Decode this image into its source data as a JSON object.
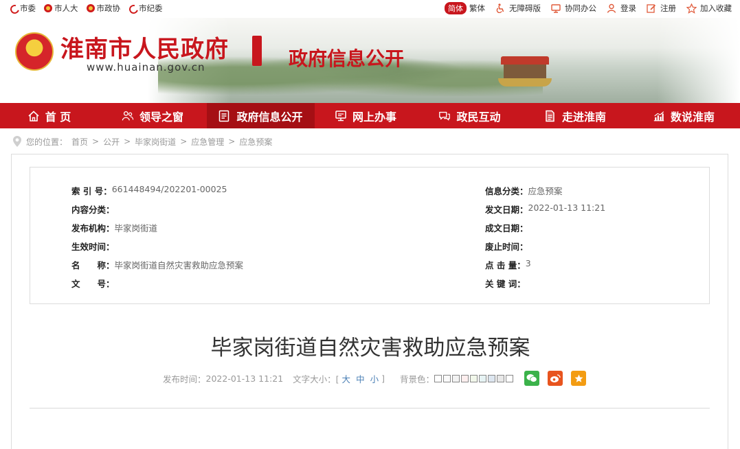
{
  "topbar": {
    "left_links": [
      "市委",
      "市人大",
      "市政协",
      "市纪委"
    ],
    "lang_simple": "简体",
    "lang_trad": "繁体",
    "right_links": [
      "无障碍版",
      "协同办公",
      "登录",
      "注册",
      "加入收藏"
    ]
  },
  "banner": {
    "site_title": "淮南市人民政府",
    "site_url": "www.huainan.gov.cn",
    "section_title": "政府信息公开"
  },
  "nav": {
    "items": [
      "首 页",
      "领导之窗",
      "政府信息公开",
      "网上办事",
      "政民互动",
      "走进淮南",
      "数说淮南"
    ]
  },
  "breadcrumb": {
    "prefix": "您的位置：",
    "path": [
      "首页",
      "公开",
      "毕家岗街道",
      "应急管理",
      "应急预案"
    ],
    "sep": ">"
  },
  "info": {
    "index_no_label": "索 引 号：",
    "index_no": "661448494/202201-00025",
    "category_label": "信息分类：",
    "category": "应急预案",
    "content_cat_label": "内容分类：",
    "content_cat": "",
    "pub_date_label": "发文日期：",
    "pub_date": "2022-01-13 11:21",
    "org_label": "发布机构：",
    "org": "毕家岗街道",
    "doc_date_label": "成文日期：",
    "doc_date": "",
    "effective_label": "生效时间：",
    "effective": "",
    "expire_label": "废止时间：",
    "expire": "",
    "name_label": "名　　称：",
    "name": "毕家岗街道自然灾害救助应急预案",
    "clicks_label": "点 击 量：",
    "clicks": "3",
    "docno_label": "文　　号：",
    "docno": "",
    "keywords_label": "关 键 词：",
    "keywords": ""
  },
  "article": {
    "title": "毕家岗街道自然灾害救助应急预案",
    "pub_time_label": "发布时间：",
    "pub_time": "2022-01-13 11:21",
    "font_size_label": "文字大小：[",
    "font_large": "大",
    "font_medium": "中",
    "font_small": "小",
    "font_close": "]",
    "bg_label": "背景色："
  },
  "colors": {
    "brand_red": "#c8161d",
    "nav_active": "#a50f14",
    "swatches": [
      "#ffffff",
      "#fafafa",
      "#f2f2f2",
      "#fdeeee",
      "#f1f7ea",
      "#e6f3f4",
      "#dde6f0",
      "#e8e8e8",
      "#ffffff"
    ],
    "wechat": "#3bb24a",
    "weibo": "#e8541e",
    "favorite": "#f39c12"
  }
}
